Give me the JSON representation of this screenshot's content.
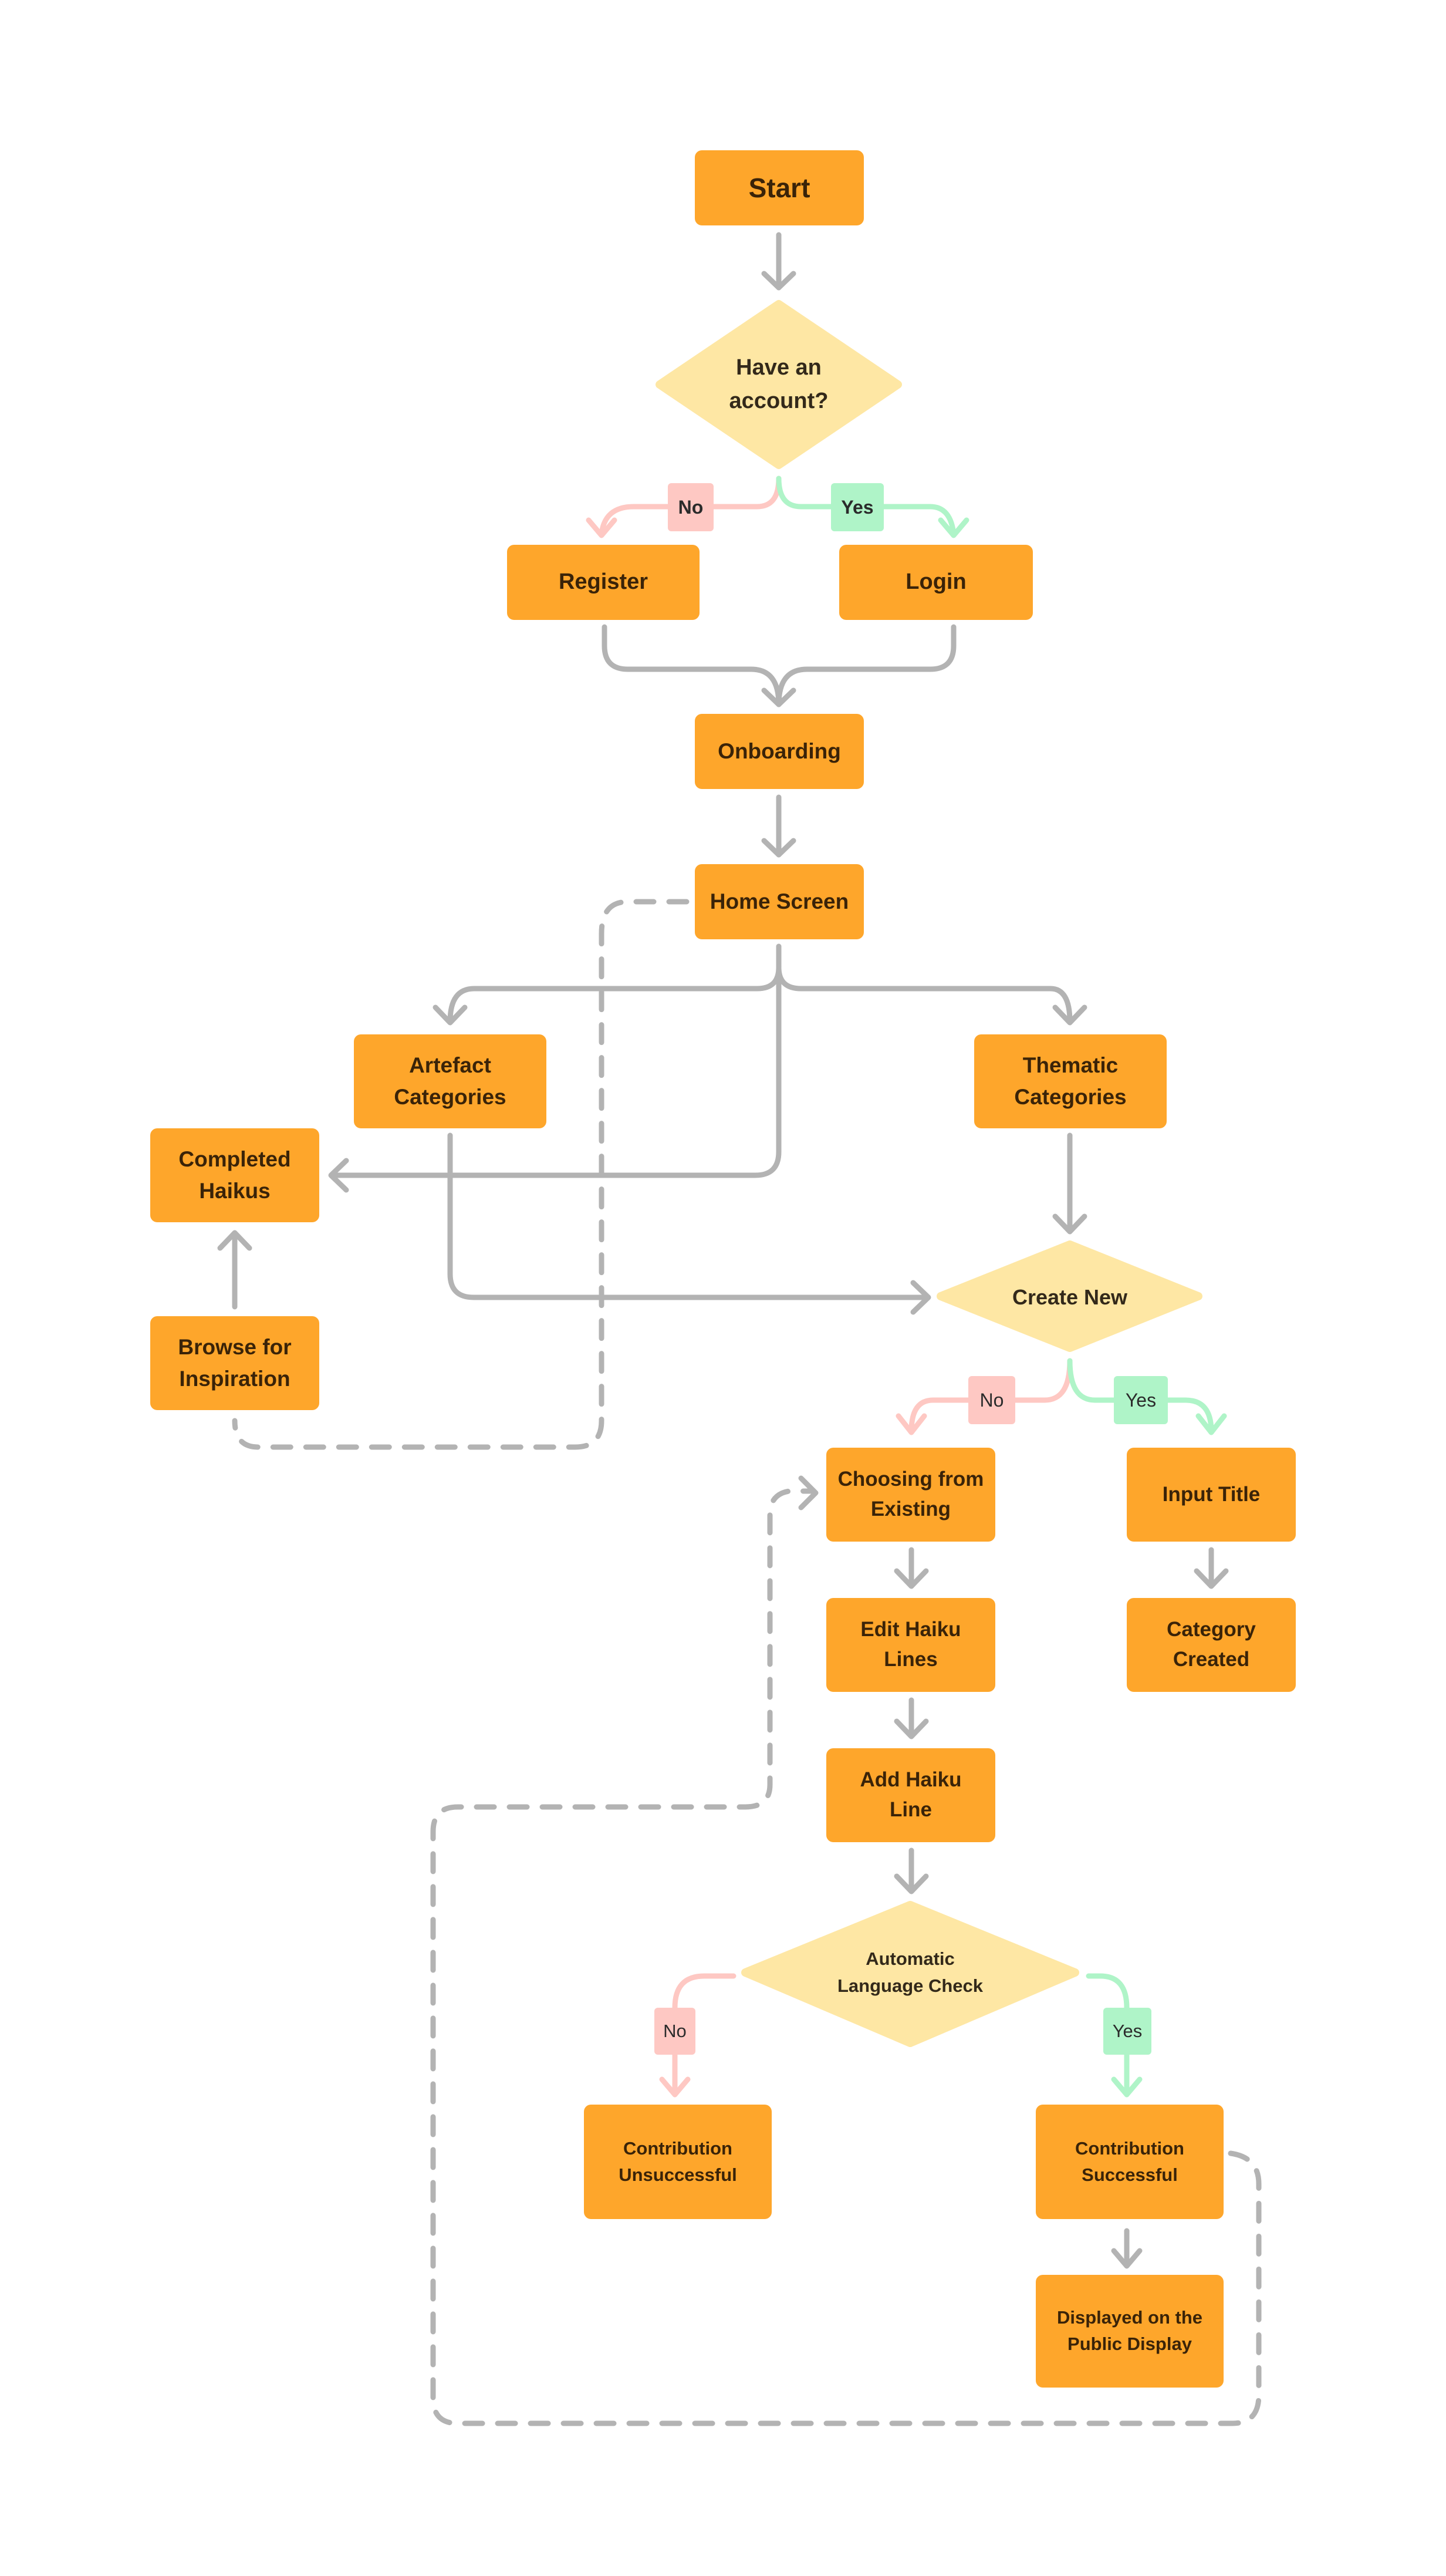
{
  "diagram": {
    "type": "flowchart",
    "colors": {
      "process_fill": "#fea62b",
      "decision_fill": "#fee7a4",
      "connector": "#b3b3b3",
      "no_branch": "#fec8c3",
      "yes_branch": "#aff4c8",
      "text": "#3a2308"
    },
    "nodes": {
      "start": "Start",
      "have_account": "Have an\naccount?",
      "register": "Register",
      "login": "Login",
      "onboarding": "Onboarding",
      "home_screen": "Home Screen",
      "artefact_categories": "Artefact\nCategories",
      "thematic_categories": "Thematic\nCategories",
      "completed_haikus": "Completed\nHaikus",
      "browse_inspiration": "Browse for\nInspiration",
      "create_new": "Create New",
      "choosing_existing": "Choosing from\nExisting",
      "input_title": "Input Title",
      "edit_haiku_lines": "Edit Haiku\nLines",
      "category_created": "Category\nCreated",
      "add_haiku_line": "Add Haiku\nLine",
      "language_check": "Automatic\nLanguage Check",
      "contribution_unsuccessful": "Contribution\nUnsuccessful",
      "contribution_successful": "Contribution\nSuccessful",
      "displayed_public": "Displayed on the\nPublic Display"
    },
    "branch_labels": {
      "account_no": "No",
      "account_yes": "Yes",
      "create_no": "No",
      "create_yes": "Yes",
      "check_no": "No",
      "check_yes": "Yes"
    },
    "edges": [
      {
        "from": "Start",
        "to": "Have an account?",
        "style": "solid"
      },
      {
        "from": "Have an account?",
        "to": "Register",
        "label": "No"
      },
      {
        "from": "Have an account?",
        "to": "Login",
        "label": "Yes"
      },
      {
        "from": "Register",
        "to": "Onboarding",
        "style": "solid"
      },
      {
        "from": "Login",
        "to": "Onboarding",
        "style": "solid"
      },
      {
        "from": "Onboarding",
        "to": "Home Screen",
        "style": "solid"
      },
      {
        "from": "Home Screen",
        "to": "Artefact Categories",
        "style": "solid"
      },
      {
        "from": "Home Screen",
        "to": "Thematic Categories",
        "style": "solid"
      },
      {
        "from": "Home Screen",
        "to": "Completed Haikus",
        "style": "solid"
      },
      {
        "from": "Artefact Categories",
        "to": "Create New",
        "style": "solid"
      },
      {
        "from": "Thematic Categories",
        "to": "Create New",
        "style": "solid"
      },
      {
        "from": "Browse for Inspiration",
        "to": "Completed Haikus",
        "style": "solid"
      },
      {
        "from": "Home Screen",
        "to": "Browse for Inspiration",
        "style": "dashed"
      },
      {
        "from": "Create New",
        "to": "Choosing from Existing",
        "label": "No"
      },
      {
        "from": "Create New",
        "to": "Input Title",
        "label": "Yes"
      },
      {
        "from": "Input Title",
        "to": "Category Created",
        "style": "solid"
      },
      {
        "from": "Choosing from Existing",
        "to": "Edit Haiku Lines",
        "style": "solid"
      },
      {
        "from": "Edit Haiku Lines",
        "to": "Add Haiku Line",
        "style": "solid"
      },
      {
        "from": "Add Haiku Line",
        "to": "Automatic Language Check",
        "style": "solid"
      },
      {
        "from": "Automatic Language Check",
        "to": "Contribution Unsuccessful",
        "label": "No"
      },
      {
        "from": "Automatic Language Check",
        "to": "Contribution Successful",
        "label": "Yes"
      },
      {
        "from": "Contribution Successful",
        "to": "Displayed on the Public Display",
        "style": "solid"
      },
      {
        "from": "Contribution Successful",
        "to": "Choosing from Existing",
        "style": "dashed"
      }
    ]
  }
}
